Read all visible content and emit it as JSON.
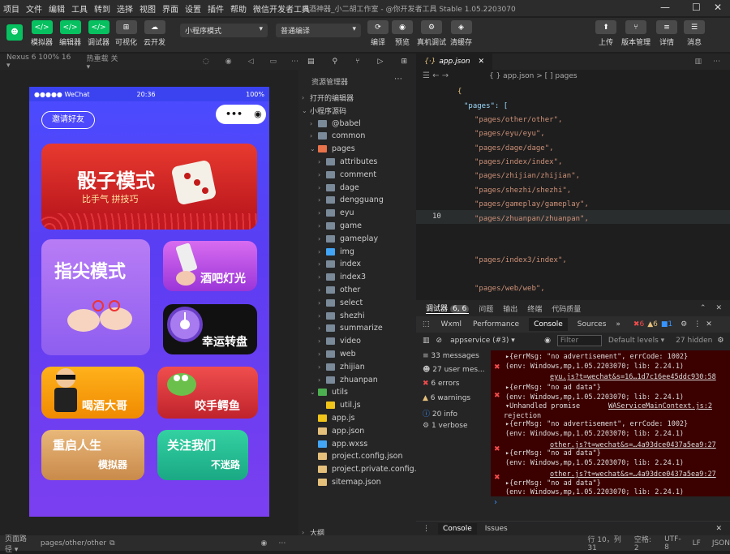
{
  "menu": {
    "items": [
      "项目",
      "文件",
      "编辑",
      "工具",
      "转到",
      "选择",
      "视图",
      "界面",
      "设置",
      "插件",
      "帮助",
      "微信开发者工具"
    ],
    "title": "喝酒神器_小二胡工作室 - @你开发者工具 Stable 1.05.2203070"
  },
  "window_controls": {
    "minimize": "—",
    "maximize": "☐",
    "close": "✕"
  },
  "toolbar": {
    "left": [
      {
        "label": "模拟器",
        "icon": "</>"
      },
      {
        "label": "编辑器",
        "icon": "</>"
      },
      {
        "label": "调试器",
        "icon": "</>"
      },
      {
        "label": "可视化",
        "icon": "⊞"
      },
      {
        "label": "云开发",
        "icon": "☁"
      }
    ],
    "mode": "小程序模式",
    "compile": "普通编译",
    "mid": [
      {
        "label": "编译",
        "icon": "⟳"
      },
      {
        "label": "预览",
        "icon": "◉"
      },
      {
        "label": "真机调试",
        "icon": "⚙"
      },
      {
        "label": "清缓存",
        "icon": "◈"
      }
    ],
    "right": [
      {
        "label": "上传",
        "icon": "⬆"
      },
      {
        "label": "版本管理",
        "icon": "⑂"
      },
      {
        "label": "详情",
        "icon": "≡"
      },
      {
        "label": "消息",
        "icon": "☰"
      }
    ]
  },
  "simulator": {
    "device": "Nexus 6 100% 16 ▾",
    "hotreload": "热重载 关 ▾"
  },
  "phone": {
    "carrier": "●●●●● WeChat",
    "time": "20:36",
    "battery": "100%",
    "invite": "邀请好友",
    "banner_title": "骰子模式",
    "banner_sub": "比手气 拼技巧",
    "cards": [
      {
        "title": "指尖模式"
      },
      {
        "title": "酒吧灯光"
      },
      {
        "title": "幸运转盘"
      },
      {
        "title": "喝酒大哥"
      },
      {
        "title": "咬手鳄鱼"
      },
      {
        "title": "重启人生",
        "sub": "模拟器"
      },
      {
        "title": "关注我们",
        "sub": "不迷路"
      }
    ]
  },
  "explorer": {
    "header": "资源管理器",
    "open_editors": "打开的编辑器",
    "project": "小程序源码",
    "outline": "大纲",
    "tree": [
      {
        "name": "@babel",
        "depth": 1,
        "type": "folder"
      },
      {
        "name": "common",
        "depth": 1,
        "type": "folder"
      },
      {
        "name": "pages",
        "depth": 1,
        "type": "folder-open"
      },
      {
        "name": "attributes",
        "depth": 2,
        "type": "folder"
      },
      {
        "name": "comment",
        "depth": 2,
        "type": "folder"
      },
      {
        "name": "dage",
        "depth": 2,
        "type": "folder"
      },
      {
        "name": "dengguang",
        "depth": 2,
        "type": "folder"
      },
      {
        "name": "eyu",
        "depth": 2,
        "type": "folder"
      },
      {
        "name": "game",
        "depth": 2,
        "type": "folder"
      },
      {
        "name": "gameplay",
        "depth": 2,
        "type": "folder"
      },
      {
        "name": "img",
        "depth": 2,
        "type": "folder-img"
      },
      {
        "name": "index",
        "depth": 2,
        "type": "folder"
      },
      {
        "name": "index3",
        "depth": 2,
        "type": "folder"
      },
      {
        "name": "other",
        "depth": 2,
        "type": "folder"
      },
      {
        "name": "select",
        "depth": 2,
        "type": "folder"
      },
      {
        "name": "shezhi",
        "depth": 2,
        "type": "folder"
      },
      {
        "name": "summarize",
        "depth": 2,
        "type": "folder"
      },
      {
        "name": "video",
        "depth": 2,
        "type": "folder"
      },
      {
        "name": "web",
        "depth": 2,
        "type": "folder"
      },
      {
        "name": "zhijian",
        "depth": 2,
        "type": "folder"
      },
      {
        "name": "zhuanpan",
        "depth": 2,
        "type": "folder"
      },
      {
        "name": "utils",
        "depth": 1,
        "type": "folder-open-green"
      },
      {
        "name": "util.js",
        "depth": 2,
        "type": "js"
      },
      {
        "name": "app.js",
        "depth": 1,
        "type": "js"
      },
      {
        "name": "app.json",
        "depth": 1,
        "type": "json"
      },
      {
        "name": "app.wxss",
        "depth": 1,
        "type": "wxss"
      },
      {
        "name": "project.config.json",
        "depth": 1,
        "type": "json"
      },
      {
        "name": "project.private.config.js...",
        "depth": 1,
        "type": "json"
      },
      {
        "name": "sitemap.json",
        "depth": 1,
        "type": "json"
      }
    ]
  },
  "editor": {
    "tab": "app.json",
    "breadcrumb": "{ } app.json > [ ] pages",
    "current_line": "10",
    "lines": [
      "{",
      "\"pages\": [",
      "\"pages/other/other\",",
      "\"pages/eyu/eyu\",",
      "\"pages/dage/dage\",",
      "\"pages/index/index\",",
      "\"pages/zhijian/zhijian\",",
      "\"pages/shezhi/shezhi\",",
      "\"pages/gameplay/gameplay\",",
      "\"pages/zhuanpan/zhuanpan\",",
      "\"pages/index3/index\",",
      "\"pages/web/web\","
    ]
  },
  "devtools": {
    "tab": "调试器",
    "badge": "6, 6",
    "tabs": [
      "问题",
      "输出",
      "终端",
      "代码质量"
    ],
    "subtabs": [
      "Wxml",
      "Performance",
      "Console",
      "Sources",
      "»"
    ],
    "counts": {
      "errors": "6",
      "warnings": "6",
      "info": "1"
    },
    "context": "appservice (#3)",
    "filter": "Filter",
    "levels": "Default levels ▾",
    "hidden": "27 hidden",
    "sidebar": [
      {
        "label": "33 messages",
        "color": "#bbb"
      },
      {
        "label": "27 user mes...",
        "color": "#bbb"
      },
      {
        "label": "6 errors",
        "color": "#f14c4c"
      },
      {
        "label": "6 warnings",
        "color": "#e5c07b"
      },
      {
        "label": "20 info",
        "color": "#3794ff"
      },
      {
        "label": "1 verbose",
        "color": "#bbb"
      }
    ],
    "log": [
      "▸{errMsg: \"no advertisement\", errCode: 1002}",
      "(env: Windows,mp,1.05.2203070; lib: 2.24.1)",
      "eyu.js?t=wechat&s=16…1d7c16ee45ddc930:58",
      "▸{errMsg: \"no ad data\"}",
      "(env: Windows,mp,1.05.2203070; lib: 2.24.1)",
      "▾Unhandled promise",
      "WAServiceMainContext.js:2",
      "rejection",
      "▸{errMsg: \"no advertisement\", errCode: 1002}",
      "(env: Windows,mp,1.05.2203070; lib: 2.24.1)",
      "other.js?t=wechat&s=…4a93dce0437a5ea9:27",
      "▸{errMsg: \"no ad data\"}",
      "(env: Windows,mp,1.05.2203070; lib: 2.24.1)",
      "other.js?t=wechat&s=…4a93dce0437a5ea9:27",
      "▸{errMsg: \"no ad data\"}",
      "(env: Windows,mp,1.05.2203070; lib: 2.24.1)"
    ],
    "bottom_tabs": [
      "Console",
      "Issues"
    ]
  },
  "status": {
    "path_label": "页面路径 ▾",
    "path": "pages/other/other",
    "cursor": "行 10，列 31",
    "spaces": "空格: 2",
    "encoding": "UTF-8",
    "eol": "LF",
    "lang": "JSON"
  }
}
